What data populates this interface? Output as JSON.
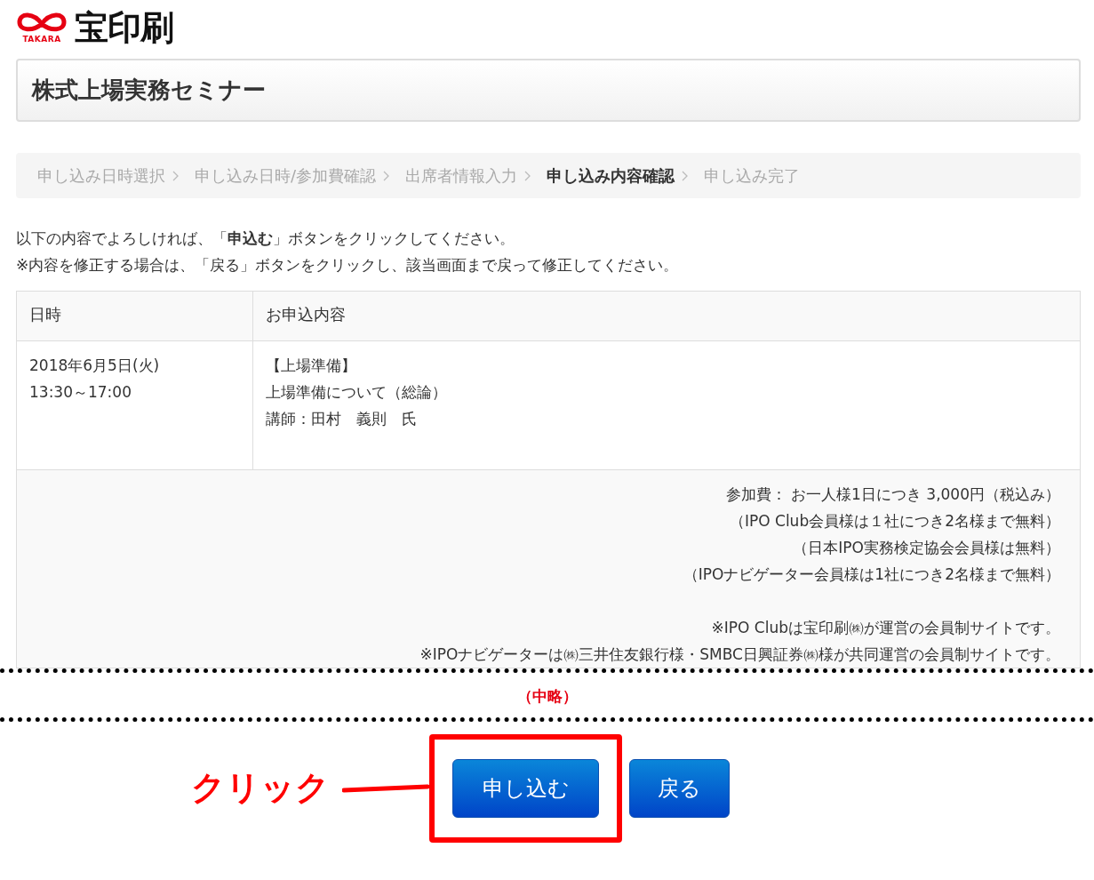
{
  "logo": {
    "mark_text": "TAKARA",
    "name": "宝印刷"
  },
  "page_title": "株式上場実務セミナー",
  "steps": [
    {
      "label": "申し込み日時選択",
      "selected": false
    },
    {
      "label": "申し込み日時/参加費確認",
      "selected": false
    },
    {
      "label": "出席者情報入力",
      "selected": false
    },
    {
      "label": "申し込み内容確認",
      "selected": true
    },
    {
      "label": "申し込み完了",
      "selected": false
    }
  ],
  "instructions": [
    "以下の内容でよろしければ、「**申込む**」ボタンをクリックしてください。",
    "※内容を修正する場合は、「戻る」ボタンをクリックし、該当画面まで戻って修正してください。"
  ],
  "table": {
    "columns": [
      "日時",
      "お申込内容"
    ],
    "rows": [
      {
        "datetime": [
          "2018年6月5日(火)",
          "13:30～17:00"
        ],
        "content": [
          "【上場準備】",
          "上場準備について（総論）",
          "講師：田村　義則　氏"
        ]
      }
    ],
    "fee_lines": [
      "参加費： お一人様1日につき 3,000円（税込み）",
      "（IPO Club会員様は１社につき2名様まで無料）",
      "（日本IPO実務検定協会会員様は無料）",
      "（IPOナビゲーター会員様は1社につき2名様まで無料）"
    ],
    "site_notes": [
      "※IPO Clubは宝印刷㈱が運営の会員制サイトです。",
      "※IPOナビゲーターは㈱三井住友銀行様・SMBC日興証券㈱様が共同運営の会員制サイトです。"
    ]
  },
  "omission_note": "（中略）",
  "buttons": [
    {
      "label": "申し込む",
      "highlighted": true
    },
    {
      "label": "戻る",
      "highlighted": false
    }
  ],
  "callout": {
    "label": "クリック"
  }
}
